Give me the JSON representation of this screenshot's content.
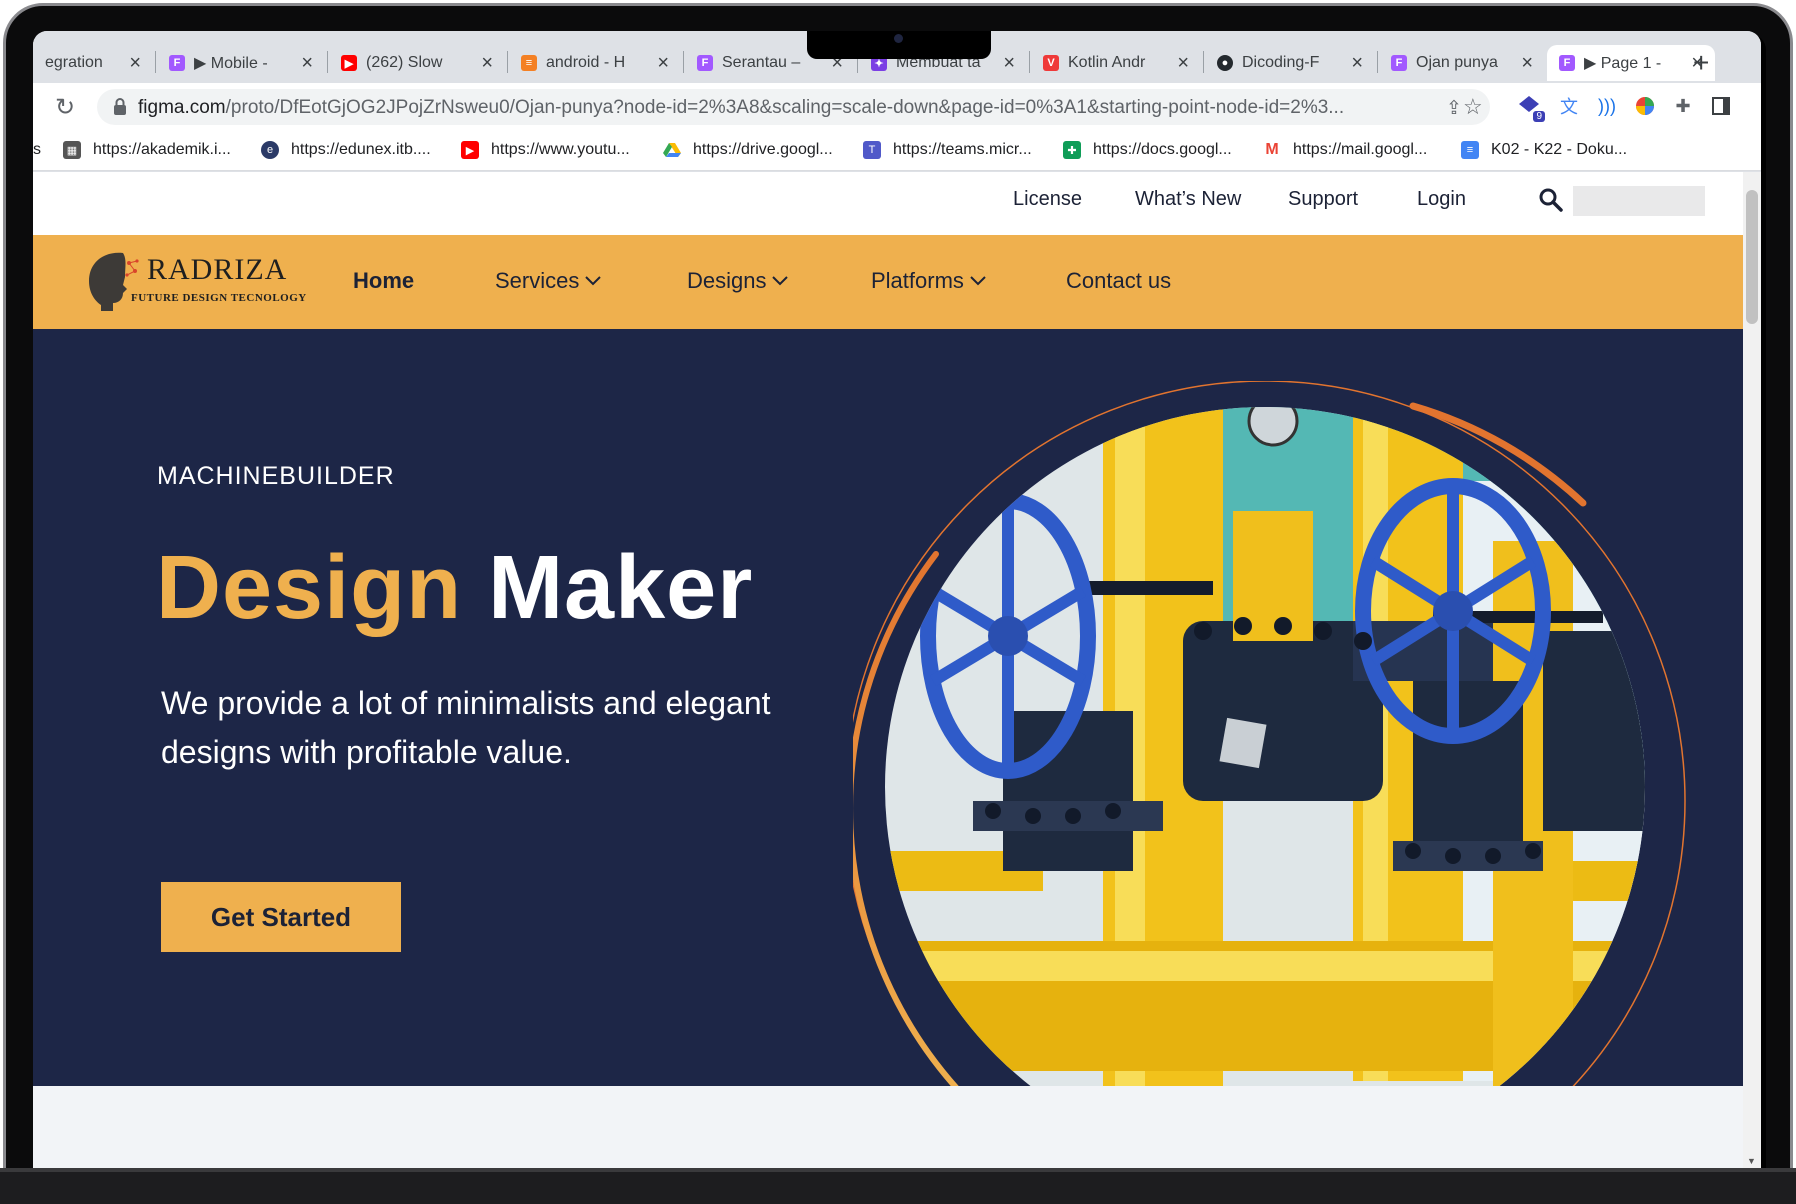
{
  "browser": {
    "tabs": [
      {
        "title": "egration",
        "icon": "figma-icon"
      },
      {
        "title": "▶ Mobile -",
        "icon": "figma-icon"
      },
      {
        "title": "(262) Slow",
        "icon": "youtube-icon"
      },
      {
        "title": "android - H",
        "icon": "stackoverflow-icon"
      },
      {
        "title": "Serantau –",
        "icon": "figma-icon"
      },
      {
        "title": "Membuat ta",
        "icon": "app-icon"
      },
      {
        "title": "Kotlin Andr",
        "icon": "vivaldi-icon"
      },
      {
        "title": "Dicoding-F",
        "icon": "github-icon"
      },
      {
        "title": "Ojan punya",
        "icon": "figma-icon"
      },
      {
        "title": "▶ Page 1 -",
        "icon": "figma-icon",
        "active": true
      }
    ],
    "new_tab_label": "+",
    "url_host": "figma.com",
    "url_rest": "/proto/DfEotGjOG2JPojZrNsweu0/Ojan-punya?node-id=2%3A8&scaling=scale-down&page-id=0%3A1&starting-point-node-id=2%3...",
    "extension_badge": "9",
    "bookmarks": [
      {
        "label": "s",
        "icon": "folder-icon"
      },
      {
        "label": "https://akademik.i...",
        "icon": "akademik-icon"
      },
      {
        "label": "https://edunex.itb....",
        "icon": "edunex-icon"
      },
      {
        "label": "https://www.youtu...",
        "icon": "youtube-icon"
      },
      {
        "label": "https://drive.googl...",
        "icon": "google-drive-icon"
      },
      {
        "label": "https://teams.micr...",
        "icon": "teams-icon"
      },
      {
        "label": "https://docs.googl...",
        "icon": "google-sheets-icon"
      },
      {
        "label": "https://mail.googl...",
        "icon": "gmail-icon"
      },
      {
        "label": "K02 - K22 - Doku...",
        "icon": "google-docs-icon"
      }
    ]
  },
  "site": {
    "toplinks": [
      "License",
      "What’s New",
      "Support",
      "Login"
    ],
    "logo": {
      "name": "RADRIZA",
      "tagline": "FUTURE DESIGN TECNOLOGY"
    },
    "nav": [
      {
        "label": "Home",
        "active": true,
        "dropdown": false
      },
      {
        "label": "Services",
        "dropdown": true
      },
      {
        "label": "Designs",
        "dropdown": true
      },
      {
        "label": "Platforms",
        "dropdown": true
      },
      {
        "label": "Contact us",
        "dropdown": false
      }
    ],
    "hero": {
      "eyebrow": "MACHINEBUILDER",
      "headline_accent": "Design",
      "headline_main": "Maker",
      "lead": "We provide a lot of minimalists and elegant designs with profitable value.",
      "cta": "Get Started",
      "image": "industrial-valves-photo"
    },
    "colors": {
      "accent": "#efb04e",
      "hero_bg": "#1d2647",
      "ring": "#e2742f",
      "text_dark": "#1c2236"
    }
  }
}
